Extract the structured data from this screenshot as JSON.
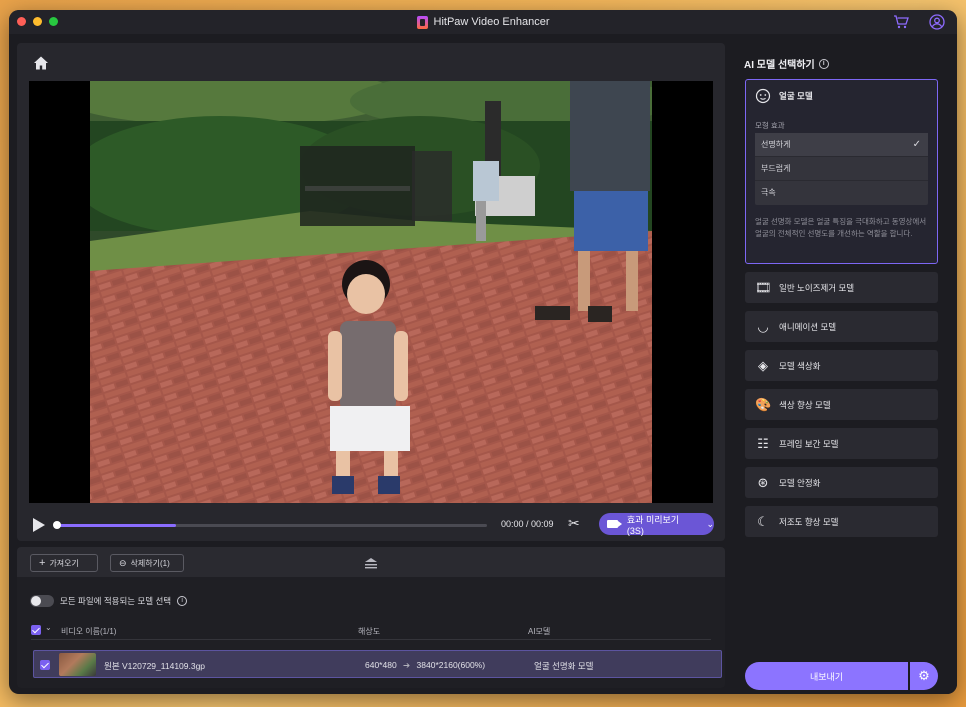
{
  "window": {
    "title": "HitPaw Video Enhancer"
  },
  "player": {
    "timecode": "00:00 / 00:09",
    "progress": 0.28,
    "preview_button": "효과 미리보기(3S)"
  },
  "files": {
    "import_button": "가져오기",
    "delete_button": "삭제하기(1)",
    "apply_all_label": "모든 파일에 적용되는 모델 선택",
    "columns": {
      "name": "비디오 이름(1/1)",
      "resolution": "해상도",
      "ai_model": "AI모델"
    },
    "rows": [
      {
        "name": "원본 V120729_114109.3gp",
        "resolution_from": "640*480",
        "resolution_to": "3840*2160(600%)",
        "model": "얼굴 선명화 모델"
      }
    ]
  },
  "sidebar": {
    "title": "AI 모델 선택하기",
    "selected_model": {
      "label": "얼굴 모델",
      "icon": "face-icon",
      "effect_label": "모형 효과",
      "options": [
        "선명하게",
        "부드럽게",
        "극속"
      ],
      "selected_option": "선명하게",
      "description": "얼굴 선명화 모델은 얼굴 특징을 극대화하고 동영상에서 얼굴의 전체적인 선명도를 개선하는 역할을 합니다."
    },
    "models": [
      {
        "label": "일반 노이즈제거 모델",
        "icon": "film-icon"
      },
      {
        "label": "애니메이션 모델",
        "icon": "anime-face-icon"
      },
      {
        "label": "모델 색상화",
        "icon": "paint-bucket-icon"
      },
      {
        "label": "색상 향상 모델",
        "icon": "palette-icon"
      },
      {
        "label": "프레임 보간 모델",
        "icon": "frames-icon"
      },
      {
        "label": "모델 안정화",
        "icon": "stabilize-icon"
      },
      {
        "label": "저조도 향상 모델",
        "icon": "moon-icon"
      }
    ],
    "export_button": "내보내기"
  },
  "colors": {
    "accent": "#8c74ff",
    "accent_dark": "#6b56d6",
    "panel": "#27272d",
    "selected_row": "#403c5c"
  }
}
